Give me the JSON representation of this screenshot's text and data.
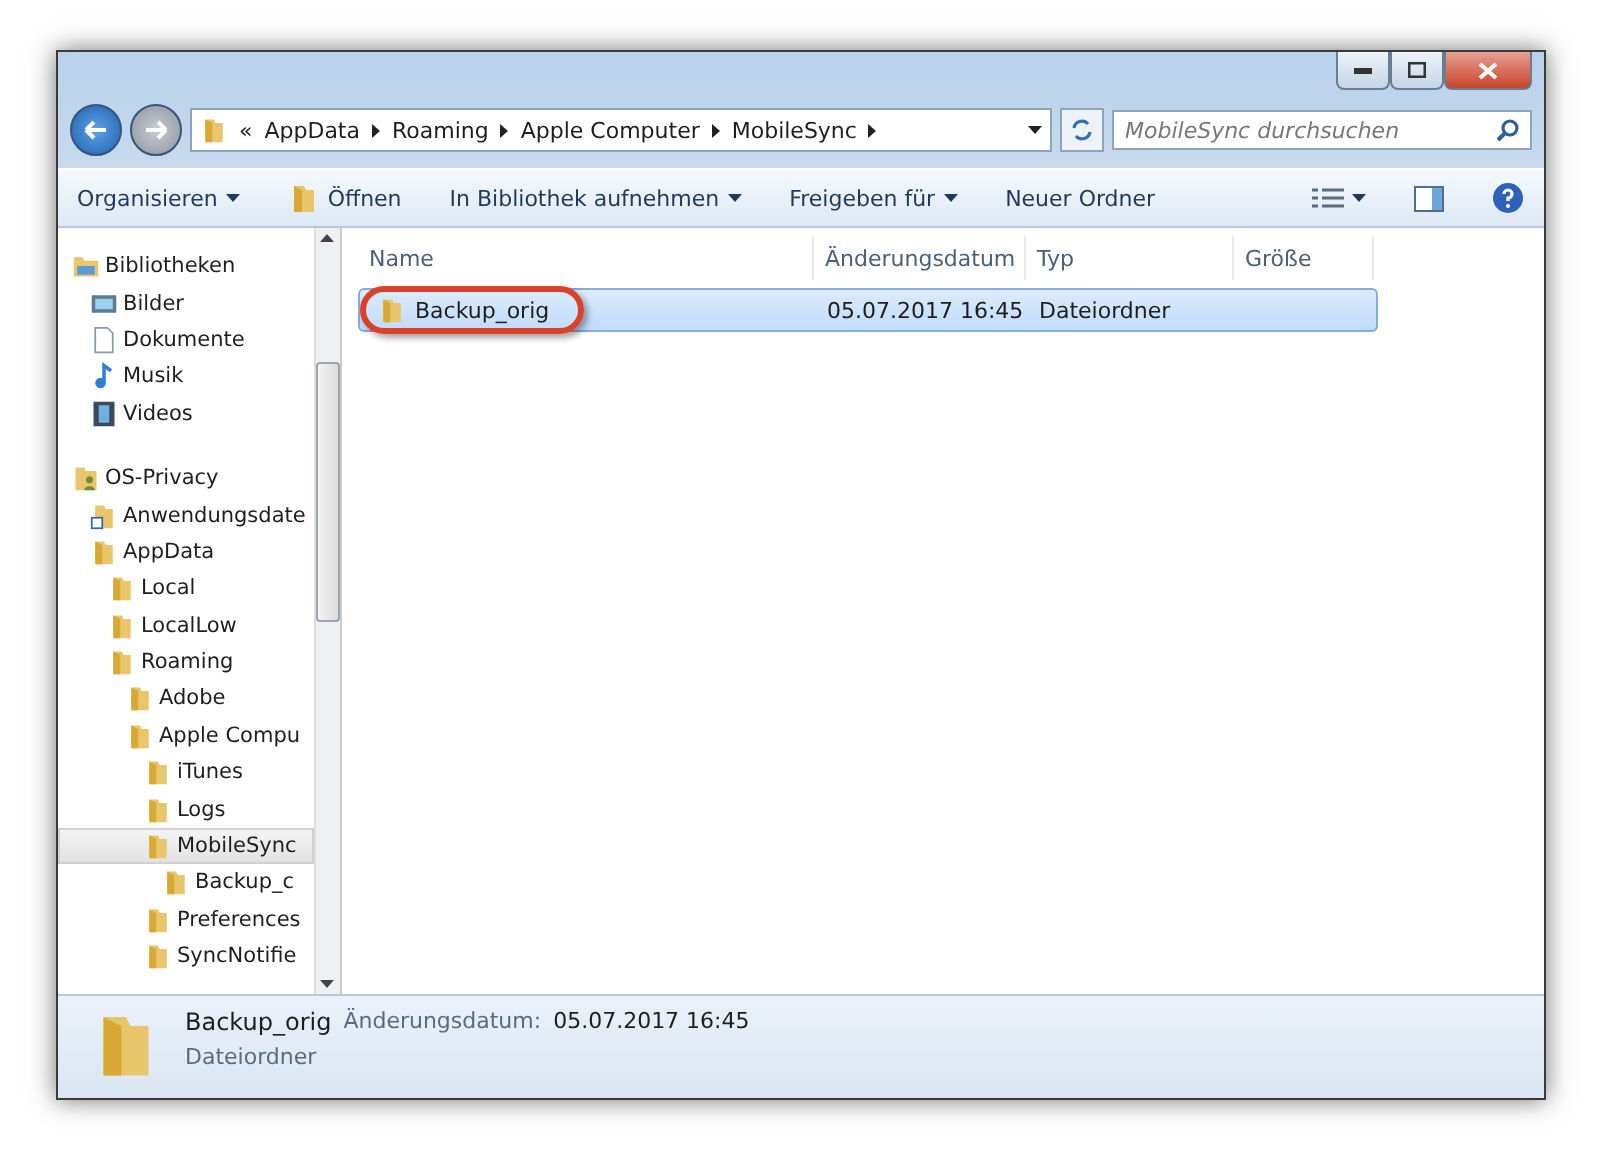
{
  "address_bar": {
    "overflow": "«",
    "segments": [
      "AppData",
      "Roaming",
      "Apple Computer",
      "MobileSync"
    ]
  },
  "search": {
    "placeholder": "MobileSync durchsuchen"
  },
  "toolbar": [
    {
      "label": "Organisieren",
      "kind": "menu"
    },
    {
      "label": "Öffnen",
      "kind": "icon"
    },
    {
      "label": "In Bibliothek aufnehmen",
      "kind": "menu"
    },
    {
      "label": "Freigeben für",
      "kind": "menu"
    },
    {
      "label": "Neuer Ordner",
      "kind": "plain"
    }
  ],
  "navigation": [
    {
      "label": "Bibliotheken",
      "kind": "library",
      "selected": false,
      "children": [
        {
          "label": "Bilder",
          "kind": "pictures",
          "selected": false
        },
        {
          "label": "Dokumente",
          "kind": "documents",
          "selected": false
        },
        {
          "label": "Musik",
          "kind": "music",
          "selected": false
        },
        {
          "label": "Videos",
          "kind": "videos",
          "selected": false
        }
      ]
    },
    {
      "label": "OS-Privacy",
      "kind": "user",
      "selected": false,
      "children": [
        {
          "label": "Anwendungsdate",
          "kind": "shortcut",
          "selected": false
        },
        {
          "label": "AppData",
          "kind": "folder",
          "selected": false,
          "children": [
            {
              "label": "Local",
              "kind": "folder",
              "selected": false
            },
            {
              "label": "LocalLow",
              "kind": "folder",
              "selected": false
            },
            {
              "label": "Roaming",
              "kind": "folder",
              "selected": false,
              "children": [
                {
                  "label": "Adobe",
                  "kind": "folder",
                  "selected": false
                },
                {
                  "label": "Apple Compu",
                  "kind": "folder",
                  "selected": false,
                  "children": [
                    {
                      "label": "iTunes",
                      "kind": "folder",
                      "selected": false
                    },
                    {
                      "label": "Logs",
                      "kind": "folder",
                      "selected": false
                    },
                    {
                      "label": "MobileSync",
                      "kind": "folder",
                      "selected": true,
                      "children": [
                        {
                          "label": "Backup_c",
                          "kind": "folder",
                          "selected": false
                        }
                      ]
                    },
                    {
                      "label": "Preferences",
                      "kind": "folder",
                      "selected": false
                    },
                    {
                      "label": "SyncNotifie",
                      "kind": "folder",
                      "selected": false
                    }
                  ]
                }
              ]
            }
          ]
        }
      ]
    }
  ],
  "table": {
    "columns": [
      "Name",
      "Änderungsdatum",
      "Typ",
      "Größe"
    ],
    "rows": [
      {
        "name": "Backup_orig",
        "date": "05.07.2017 16:45",
        "type": "Dateiordner",
        "selected": true,
        "highlighted": true
      }
    ]
  },
  "details": {
    "name": "Backup_orig",
    "date_label": "Änderungsdatum:",
    "date": "05.07.2017 16:45",
    "type": "Dateiordner"
  }
}
